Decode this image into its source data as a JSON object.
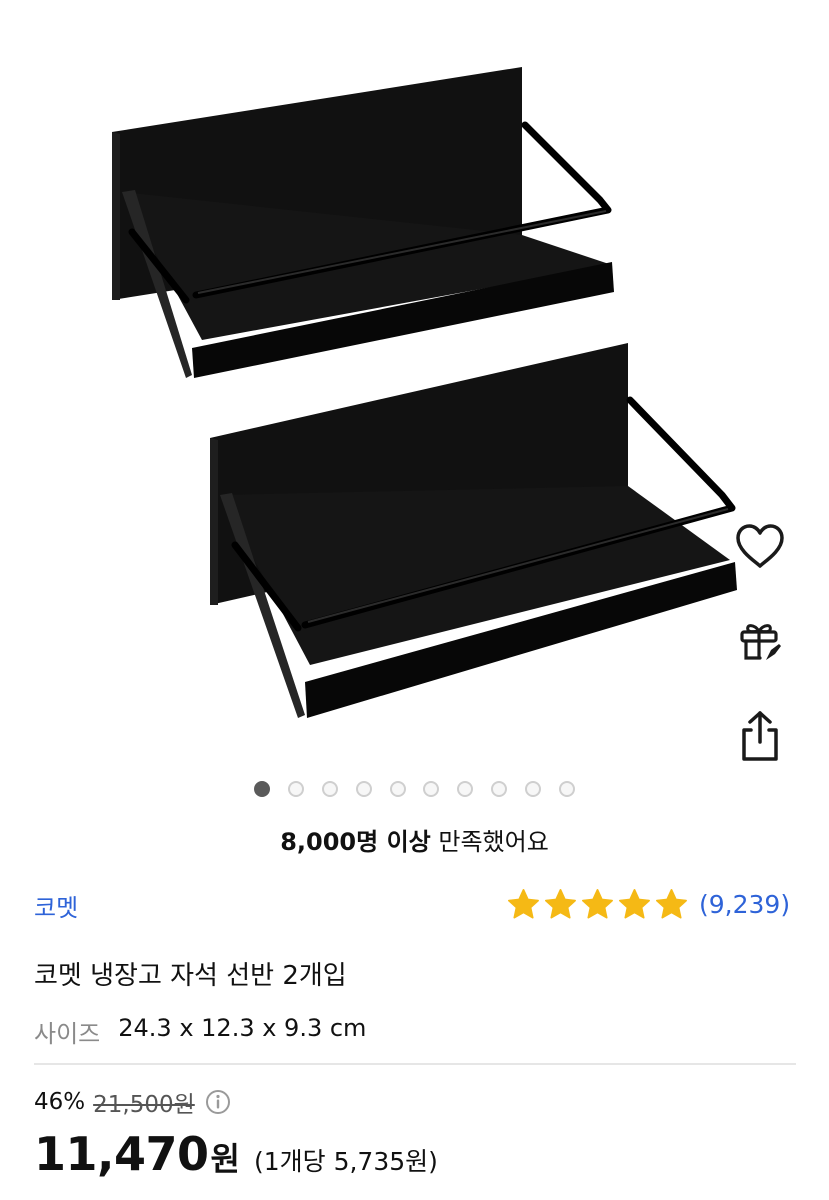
{
  "gallery": {
    "image_subject": "two black magnetic shelves",
    "total_images": 10,
    "active_index": 0
  },
  "actions": {
    "like_icon": "heart-icon",
    "gift_icon": "gift-icon",
    "share_icon": "share-icon"
  },
  "satisfaction": {
    "highlight": "8,000명 이상",
    "suffix": "만족했어요"
  },
  "product": {
    "brand": "코멧",
    "title": "코멧 냉장고 자석 선반 2개입",
    "option_label": "사이즈",
    "option_value": "24.3 x 12.3 x 9.3 cm"
  },
  "rating": {
    "stars": 5,
    "max_stars": 5,
    "review_count": "(9,239)"
  },
  "pricing": {
    "discount_rate": "46%",
    "original_price": "21,500원",
    "sale_price": "11,470",
    "currency": "원",
    "unit_price": "(1개당 5,735원)"
  },
  "colors": {
    "link": "#2e63d8",
    "star": "#f5b915",
    "active_dot": "#5a5a5a",
    "inactive_dot": "#cfcfcf"
  }
}
